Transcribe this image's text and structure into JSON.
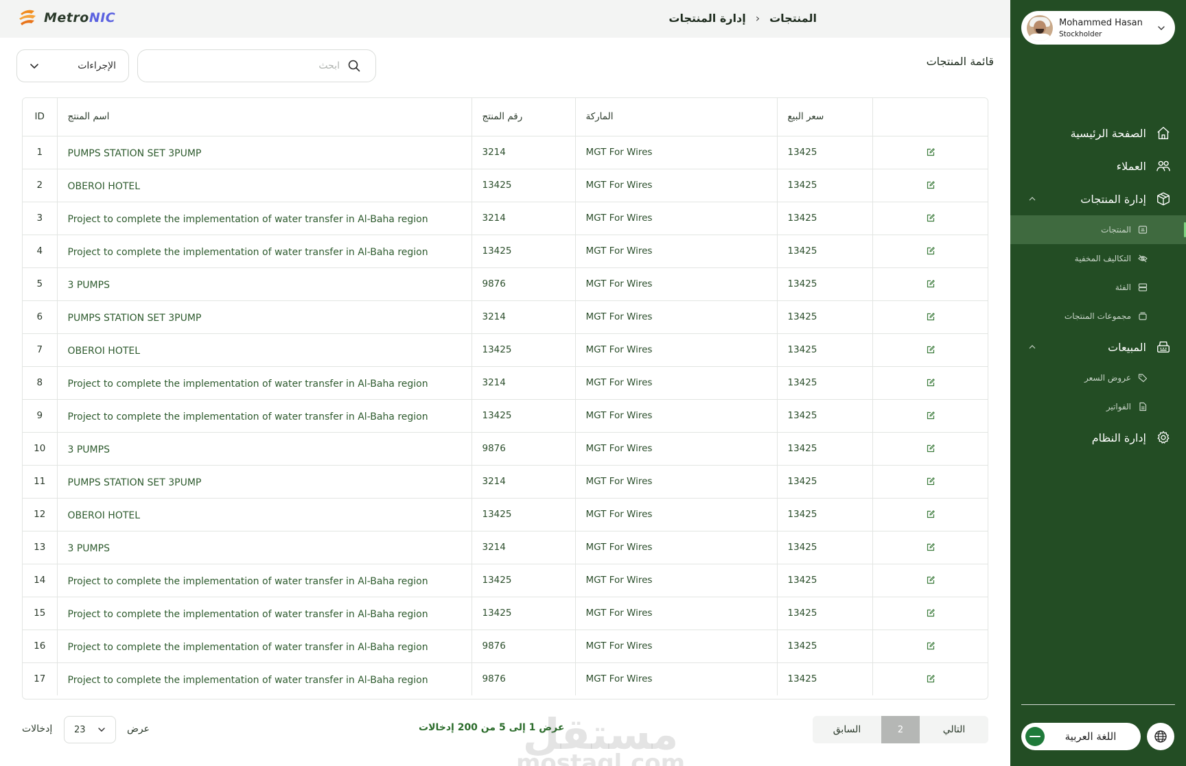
{
  "brand": {
    "name_part1": "Metro",
    "name_part2": "NIC"
  },
  "breadcrumb": {
    "parent": "إدارة المنتجات",
    "current": "المنتجات"
  },
  "page": {
    "title": "قائمة المنتجات"
  },
  "toolbar": {
    "search_placeholder": "ابحث",
    "actions_label": "الإجراءات"
  },
  "table": {
    "headers": {
      "id": "ID",
      "name": "اسم المنتج",
      "number": "رقم المنتج",
      "brand": "الماركة",
      "price": "سعر البيع"
    },
    "rows": [
      {
        "id": "1",
        "name": "PUMPS STATION SET 3PUMP",
        "number": "3214",
        "brand": "MGT For Wires",
        "price": "13425"
      },
      {
        "id": "2",
        "name": "OBEROI HOTEL",
        "number": "13425",
        "brand": "MGT For Wires",
        "price": "13425"
      },
      {
        "id": "3",
        "name": "Project to complete the implementation of water transfer in Al-Baha region",
        "number": "3214",
        "brand": "MGT For Wires",
        "price": "13425"
      },
      {
        "id": "4",
        "name": "Project to complete the implementation of water transfer in Al-Baha region",
        "number": "13425",
        "brand": "MGT For Wires",
        "price": "13425"
      },
      {
        "id": "5",
        "name": "3 PUMPS",
        "number": "9876",
        "brand": "MGT For Wires",
        "price": "13425"
      },
      {
        "id": "6",
        "name": "PUMPS STATION SET 3PUMP",
        "number": "3214",
        "brand": "MGT For Wires",
        "price": "13425"
      },
      {
        "id": "7",
        "name": "OBEROI HOTEL",
        "number": "13425",
        "brand": "MGT For Wires",
        "price": "13425"
      },
      {
        "id": "8",
        "name": "Project to complete the implementation of water transfer in Al-Baha region",
        "number": "3214",
        "brand": "MGT For Wires",
        "price": "13425"
      },
      {
        "id": "9",
        "name": "Project to complete the implementation of water transfer in Al-Baha region",
        "number": "13425",
        "brand": "MGT For Wires",
        "price": "13425"
      },
      {
        "id": "10",
        "name": "3 PUMPS",
        "number": "9876",
        "brand": "MGT For Wires",
        "price": "13425"
      },
      {
        "id": "11",
        "name": "PUMPS STATION SET 3PUMP",
        "number": "3214",
        "brand": "MGT For Wires",
        "price": "13425"
      },
      {
        "id": "12",
        "name": "OBEROI HOTEL",
        "number": "13425",
        "brand": "MGT For Wires",
        "price": "13425"
      },
      {
        "id": "13",
        "name": "3 PUMPS",
        "number": "3214",
        "brand": "MGT For Wires",
        "price": "13425"
      },
      {
        "id": "14",
        "name": "Project to complete the implementation of water transfer in Al-Baha region",
        "number": "13425",
        "brand": "MGT For Wires",
        "price": "13425"
      },
      {
        "id": "15",
        "name": "Project to complete the implementation of water transfer in Al-Baha region",
        "number": "13425",
        "brand": "MGT For Wires",
        "price": "13425"
      },
      {
        "id": "16",
        "name": "Project to complete the implementation of water transfer in Al-Baha region",
        "number": "9876",
        "brand": "MGT For Wires",
        "price": "13425"
      },
      {
        "id": "17",
        "name": "Project to complete the implementation of water transfer in Al-Baha region",
        "number": "9876",
        "brand": "MGT For Wires",
        "price": "13425"
      }
    ]
  },
  "footer": {
    "entries_label": "إدخالات",
    "entries_value": "23",
    "show_label": "عرض",
    "showing_text": "عرض 1 إلى 5 من 200 إدخالات",
    "prev_label": "السابق",
    "current_page": "2",
    "next_label": "التالي"
  },
  "watermark": {
    "arabic": "مستقل",
    "latin": "mostaql.com"
  },
  "user": {
    "name": "Mohammed Hasan",
    "role": "Stockholder"
  },
  "sidebar": {
    "home": "الصفحة الرئيسية",
    "customers": "العملاء",
    "products_mgmt": "إدارة المنتجات",
    "products": "المنتجات",
    "hidden_costs": "التكاليف المخفية",
    "category": "الفئة",
    "product_groups": "مجموعات المنتجات",
    "sales": "المبيعات",
    "quotes": "عروض السعر",
    "invoices": "الفواتير",
    "system_mgmt": "إدارة النظام",
    "language": "اللغة العربية"
  },
  "colors": {
    "sidebar_bg": "#234d24",
    "accent_green": "#2a6b2a",
    "brand_orange": "#f08a1c",
    "brand_purple": "#5b62e0"
  },
  "icons": {
    "logo": "metronic-logo-icon",
    "search": "search-icon",
    "chevron": "chevron-down-icon",
    "edit": "edit-icon",
    "home": "home-icon",
    "customers": "users-icon",
    "products": "box-icon",
    "sales": "cash-register-icon",
    "settings": "gear-icon",
    "globe": "globe-icon"
  }
}
